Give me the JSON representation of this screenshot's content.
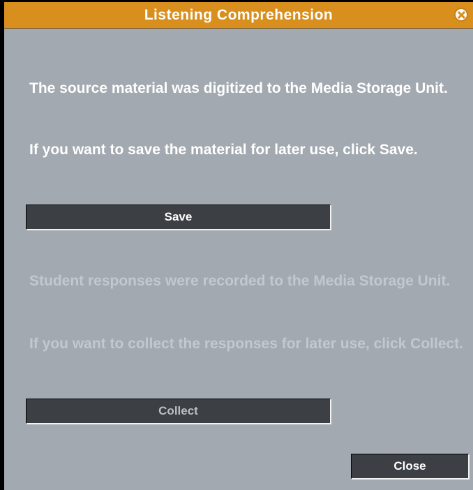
{
  "window": {
    "title": "Listening Comprehension",
    "close_icon": "close-circle-icon"
  },
  "source_section": {
    "message_1": "The source material was digitized to the Media Storage Unit.",
    "message_2": "If you want to save the material for later use, click Save.",
    "save_label": "Save",
    "enabled": true
  },
  "responses_section": {
    "message_1": "Student responses were recorded to the Media Storage Unit.",
    "message_2": "If you want to collect the responses for later use, click Collect.",
    "collect_label": "Collect",
    "enabled": false
  },
  "footer": {
    "close_label": "Close"
  },
  "colors": {
    "titlebar": "#d98f1e",
    "background": "#a2a9b0",
    "button": "#3c3f43",
    "enabled_text": "#ffffff",
    "disabled_text": "#c2c8cd"
  }
}
